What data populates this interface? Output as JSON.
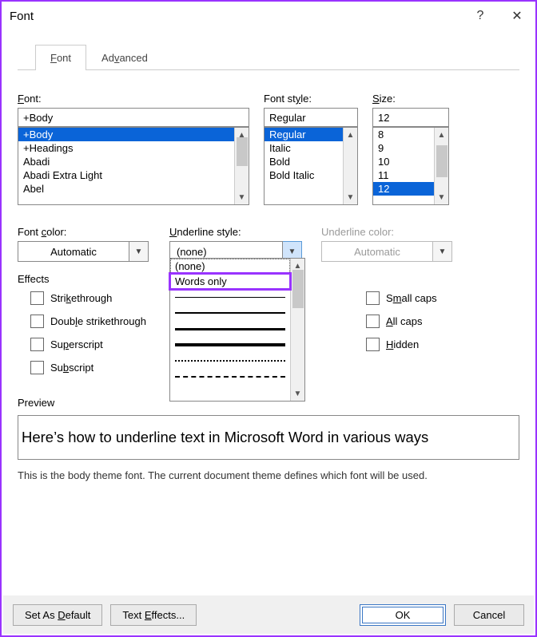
{
  "titlebar": {
    "title": "Font",
    "help": "?",
    "close": "✕"
  },
  "tabs": {
    "font": "Font",
    "advanced": "Advanced"
  },
  "font": {
    "label": "Font:",
    "value": "+Body",
    "list": [
      "+Body",
      "+Headings",
      "Abadi",
      "Abadi Extra Light",
      "Abel"
    ],
    "selected": "+Body"
  },
  "style": {
    "label": "Font style:",
    "value": "Regular",
    "list": [
      "Regular",
      "Italic",
      "Bold",
      "Bold Italic"
    ],
    "selected": "Regular"
  },
  "size": {
    "label": "Size:",
    "value": "12",
    "list": [
      "8",
      "9",
      "10",
      "11",
      "12"
    ],
    "selected": "12"
  },
  "fontcolor": {
    "label": "Font color:",
    "value": "Automatic"
  },
  "underline": {
    "label": "Underline style:",
    "value": "(none)",
    "dropdown": {
      "none": "(none)",
      "wordsonly": "Words only"
    }
  },
  "ulcolor": {
    "label": "Underline color:",
    "value": "Automatic"
  },
  "effects": {
    "label": "Effects",
    "strikethrough": "Strikethrough",
    "double": "Double strikethrough",
    "superscript": "Superscript",
    "subscript": "Subscript",
    "smallcaps": "Small caps",
    "allcaps": "All caps",
    "hidden": "Hidden"
  },
  "preview": {
    "label": "Preview",
    "text": "Here’s how to underline text in Microsoft Word in various ways",
    "note": "This is the body theme font. The current document theme defines which font will be used."
  },
  "footer": {
    "setdefault": "Set As Default",
    "texteffects": "Text Effects...",
    "ok": "OK",
    "cancel": "Cancel"
  }
}
